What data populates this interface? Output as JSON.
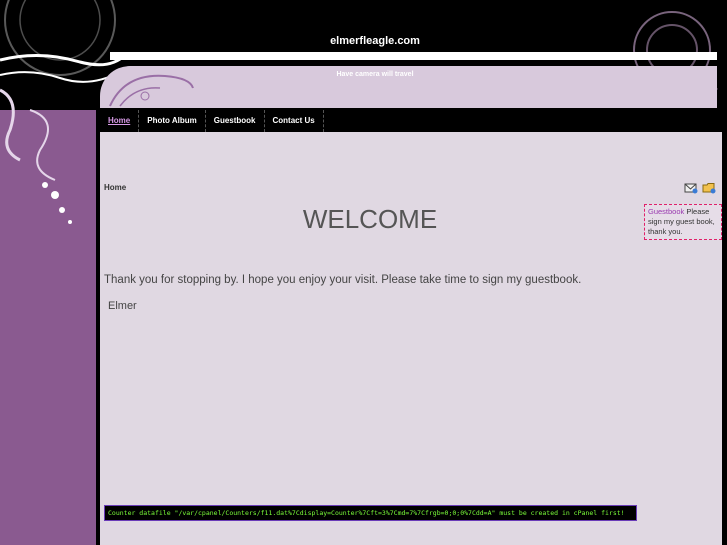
{
  "site": {
    "title": "elmerfleagle.com",
    "tagline": "Have camera will travel"
  },
  "nav": {
    "items": [
      {
        "label": "Home",
        "active": true
      },
      {
        "label": "Photo Album",
        "active": false
      },
      {
        "label": "Guestbook",
        "active": false
      },
      {
        "label": "Contact Us",
        "active": false
      }
    ]
  },
  "content": {
    "breadcrumb": "Home",
    "heading": "WELCOME",
    "body": "Thank you for stopping by.  I hope you enjoy your visit. Please take time to sign my guestbook.",
    "signature": "Elmer"
  },
  "guestbook_box": {
    "link": "Guestbook",
    "text": "Please sign my guest book, thank you."
  },
  "icons": [
    "mail-icon",
    "folder-icon"
  ],
  "counter": {
    "text": "Counter datafile \"/var/cpanel/Counters/f11.dat%7Cdisplay=Counter%7Cft=3%7Cmd=7%7Cfrgb=0;0;0%7Cdd=A\" must be created in cPanel first!"
  },
  "colors": {
    "purple": "#8a5a90",
    "lavender": "#d8c9dc",
    "content_bg": "#e0d8e2",
    "nav_active": "#d79ae6",
    "counter_text": "#7bff3a"
  }
}
